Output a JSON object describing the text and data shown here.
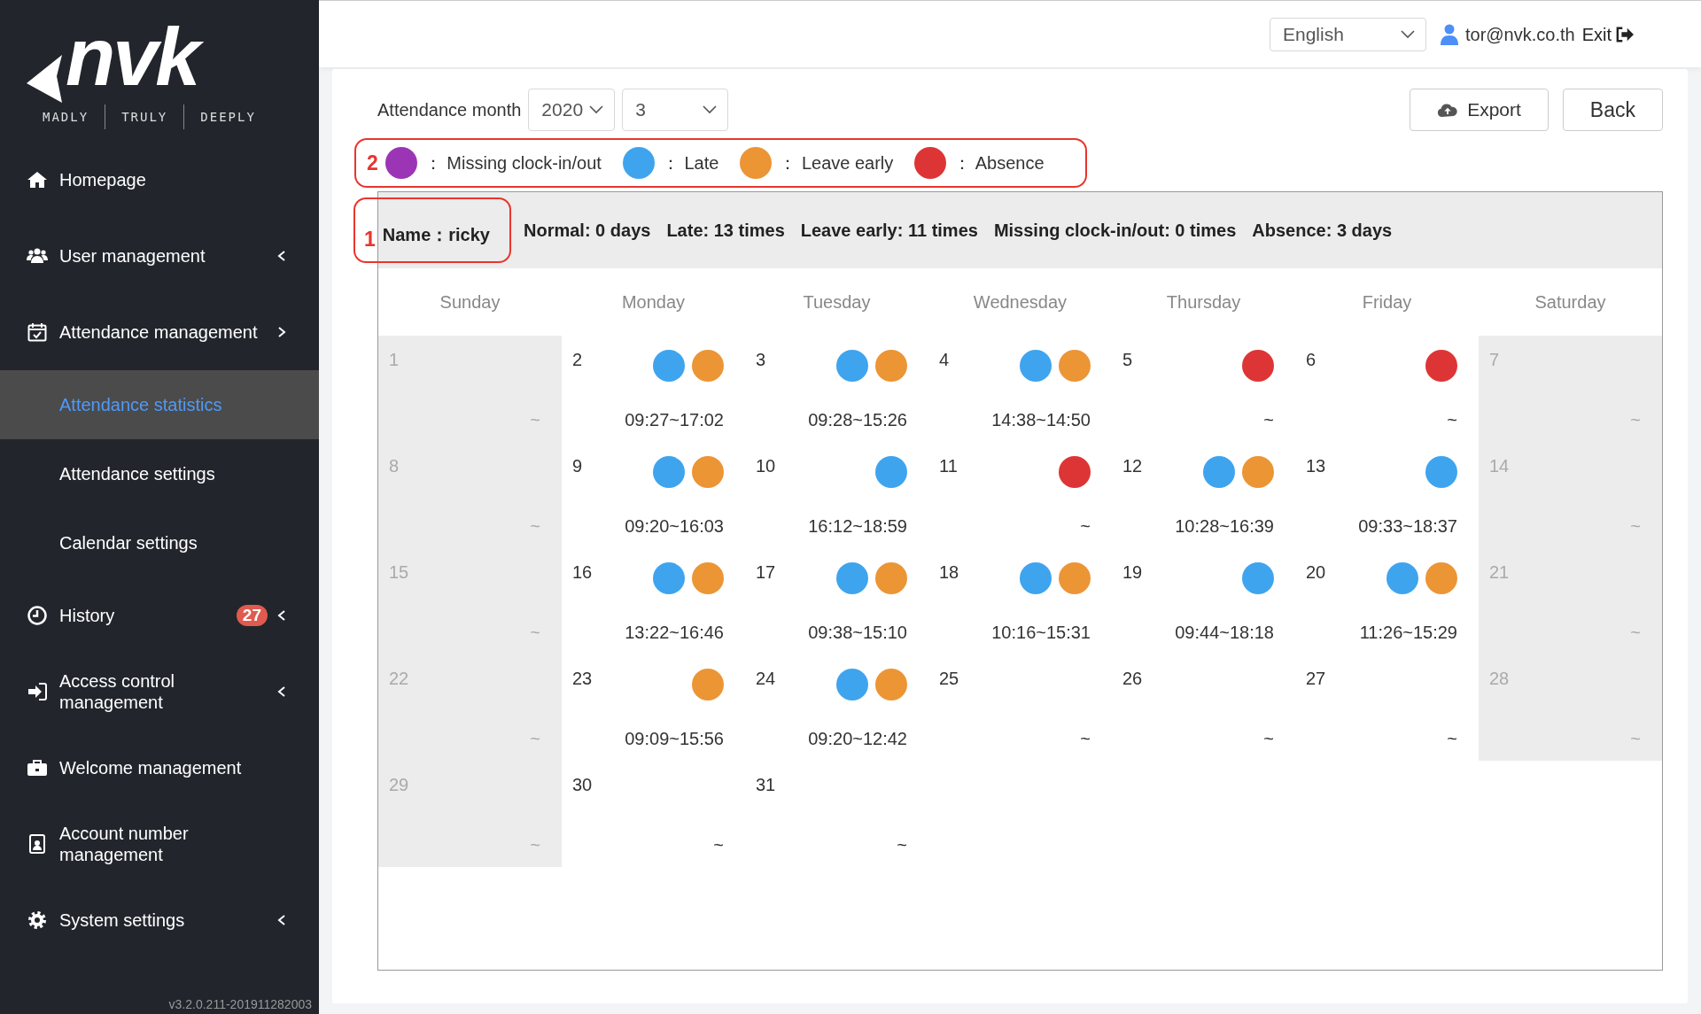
{
  "sidebar": {
    "logo": {
      "wordmark": "nvk",
      "taglines": [
        "MADLY",
        "TRULY",
        "DEEPLY"
      ]
    },
    "items": [
      {
        "label": "Homepage",
        "selected": false
      },
      {
        "label": "User management",
        "selected": false,
        "expanded": false
      },
      {
        "label": "Attendance management",
        "selected": false,
        "expanded": true,
        "children": [
          {
            "label": "Attendance statistics",
            "selected": true
          },
          {
            "label": "Attendance settings",
            "selected": false
          },
          {
            "label": "Calendar settings",
            "selected": false
          }
        ]
      },
      {
        "label": "History",
        "selected": false,
        "expanded": false,
        "badge": "27"
      },
      {
        "label": "Access control management",
        "selected": false,
        "expanded": false
      },
      {
        "label": "Welcome management",
        "selected": false
      },
      {
        "label": "Account number management",
        "selected": false
      },
      {
        "label": "System settings",
        "selected": false,
        "expanded": false
      }
    ],
    "version": "v3.2.0.211-201911282003"
  },
  "header": {
    "language": "English",
    "user": "tor@nvk.co.th",
    "exit": "Exit"
  },
  "toolbar": {
    "label": "Attendance month",
    "year": "2020",
    "month": "3",
    "buttons": [
      {
        "kind": "export",
        "label": "Export"
      },
      {
        "kind": "back",
        "label": "Back"
      }
    ]
  },
  "legend": {
    "marker": "2",
    "items": [
      {
        "kind": "missing",
        "color": "#9b35b5",
        "label": "： Missing clock-in/out"
      },
      {
        "kind": "late",
        "color": "#3fa4ee",
        "label": "： Late"
      },
      {
        "kind": "early",
        "color": "#ec9535",
        "label": "： Leave early"
      },
      {
        "kind": "absence",
        "color": "#dd3535",
        "label": "： Absence"
      }
    ]
  },
  "summary": {
    "marker": "1",
    "name": "Name：ricky",
    "stats": [
      "Normal: 0 days",
      "Late: 13 times",
      "Leave early: 11 times",
      "Missing clock-in/out: 0 times",
      "Absence: 3 days"
    ]
  },
  "calendar": {
    "weekdays": [
      "Sunday",
      "Monday",
      "Tuesday",
      "Wednesday",
      "Thursday",
      "Friday",
      "Saturday"
    ],
    "days": [
      {
        "day": "1",
        "weekend": true,
        "time": "~"
      },
      {
        "day": "2",
        "weekend": false,
        "late": true,
        "early": true,
        "time": "09:27~17:02"
      },
      {
        "day": "3",
        "weekend": false,
        "late": true,
        "early": true,
        "time": "09:28~15:26"
      },
      {
        "day": "4",
        "weekend": false,
        "late": true,
        "early": true,
        "time": "14:38~14:50"
      },
      {
        "day": "5",
        "weekend": false,
        "absence": true,
        "time": "~"
      },
      {
        "day": "6",
        "weekend": false,
        "absence": true,
        "time": "~"
      },
      {
        "day": "7",
        "weekend": true,
        "time": "~"
      },
      {
        "day": "8",
        "weekend": true,
        "time": "~"
      },
      {
        "day": "9",
        "weekend": false,
        "late": true,
        "early": true,
        "time": "09:20~16:03"
      },
      {
        "day": "10",
        "weekend": false,
        "late": true,
        "time": "16:12~18:59"
      },
      {
        "day": "11",
        "weekend": false,
        "absence": true,
        "time": "~"
      },
      {
        "day": "12",
        "weekend": false,
        "late": true,
        "early": true,
        "time": "10:28~16:39"
      },
      {
        "day": "13",
        "weekend": false,
        "late": true,
        "time": "09:33~18:37"
      },
      {
        "day": "14",
        "weekend": true,
        "time": "~"
      },
      {
        "day": "15",
        "weekend": true,
        "time": "~"
      },
      {
        "day": "16",
        "weekend": false,
        "late": true,
        "early": true,
        "time": "13:22~16:46"
      },
      {
        "day": "17",
        "weekend": false,
        "late": true,
        "early": true,
        "time": "09:38~15:10"
      },
      {
        "day": "18",
        "weekend": false,
        "late": true,
        "early": true,
        "time": "10:16~15:31"
      },
      {
        "day": "19",
        "weekend": false,
        "late": true,
        "time": "09:44~18:18"
      },
      {
        "day": "20",
        "weekend": false,
        "late": true,
        "early": true,
        "time": "11:26~15:29"
      },
      {
        "day": "21",
        "weekend": true,
        "time": "~"
      },
      {
        "day": "22",
        "weekend": true,
        "time": "~"
      },
      {
        "day": "23",
        "weekend": false,
        "early": true,
        "time": "09:09~15:56"
      },
      {
        "day": "24",
        "weekend": false,
        "late": true,
        "early": true,
        "time": "09:20~12:42"
      },
      {
        "day": "25",
        "weekend": false,
        "time": "~"
      },
      {
        "day": "26",
        "weekend": false,
        "time": "~"
      },
      {
        "day": "27",
        "weekend": false,
        "time": "~"
      },
      {
        "day": "28",
        "weekend": true,
        "time": "~"
      },
      {
        "day": "29",
        "weekend": true,
        "time": "~"
      },
      {
        "day": "30",
        "weekend": false,
        "time": "~"
      },
      {
        "day": "31",
        "weekend": false,
        "time": "~"
      }
    ]
  }
}
